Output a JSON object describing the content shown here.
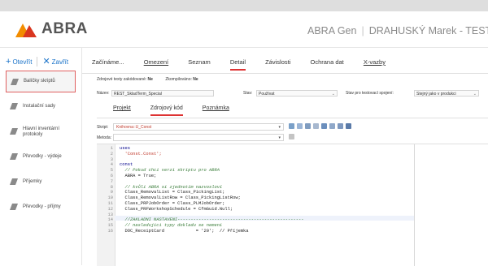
{
  "header": {
    "logo": "ABRA",
    "product": "ABRA Gen",
    "user": "DRAHUSKÝ Marek - TEST",
    "colors": {
      "logo_orange": "#f28c00",
      "logo_red": "#d9361f"
    }
  },
  "sidebar": {
    "open_label": "Otevřít",
    "close_label": "Zavřít",
    "items": [
      {
        "label": "Balíčky skriptů",
        "active": true
      },
      {
        "label": "Instalační sady"
      },
      {
        "label": "Hlavní inventární protokoly"
      },
      {
        "label": "Převodky - výdeje"
      },
      {
        "label": "Příjemky"
      },
      {
        "label": "Převodky - příjmy"
      }
    ]
  },
  "main_tabs": [
    "Začínáme...",
    "Omezení",
    "Seznam",
    "Detail",
    "Závislosti",
    "Ochrana dat",
    "X-vazby"
  ],
  "active_main_tab": "Detail",
  "info": {
    "encrypted_label": "Zdrojové texty zakódované:",
    "encrypted_value": "Ne",
    "compiled_label": "Zkompilováno:",
    "compiled_value": "Ne"
  },
  "form": {
    "name_label": "Název:",
    "name_value": "REST_SkladTerm_Special",
    "status_label": "Stav:",
    "status_value": "Používat",
    "test_label": "Stav pro testovací spojení:",
    "test_value": "Stejný jako v produkci"
  },
  "sub_tabs": [
    "Projekt",
    "Zdrojový kód",
    "Poznámka"
  ],
  "active_sub_tab": "Zdrojový kód",
  "script": {
    "label": "Skript:",
    "value": "Knihovna::U_Const",
    "method_label": "Metoda:",
    "method_value": ""
  },
  "code": {
    "lines": [
      {
        "n": "1",
        "t": "uses",
        "c": "kw"
      },
      {
        "n": "2",
        "t": "  'Const.Const';",
        "c": "st"
      },
      {
        "n": "3",
        "t": "",
        "c": "nm"
      },
      {
        "n": "4",
        "t": "const",
        "c": "kw"
      },
      {
        "n": "5",
        "t": "  // Pokud chci verzi skriptu pro ABRA",
        "c": "cm"
      },
      {
        "n": "6",
        "t": "  ABRA = True;",
        "c": "nm"
      },
      {
        "n": "7",
        "t": "",
        "c": "nm"
      },
      {
        "n": "8",
        "t": "  // kvůli ABRA si zjednotím nazvosloví",
        "c": "cm"
      },
      {
        "n": "9",
        "t": "  Class_RemovalList = Class_PickingList;",
        "c": "nm"
      },
      {
        "n": "10",
        "t": "  Class_RemovalListRow = Class_PickingListRow;",
        "c": "nm"
      },
      {
        "n": "11",
        "t": "  Class_PRPJobOrder = Class_PLMJobOrder;",
        "c": "nm"
      },
      {
        "n": "12",
        "t": "  Class_PRFWorkshopSchedule = CfmGuid.Null;",
        "c": "nm"
      },
      {
        "n": "13",
        "t": "",
        "c": "nm"
      },
      {
        "n": "14",
        "t": "  //ZAKLADNI NASTAVENI------------------------------------------------",
        "c": "cm"
      },
      {
        "n": "15",
        "t": "  // nasledujici typy dokladu se nemeni",
        "c": "cm"
      },
      {
        "n": "16",
        "t": "  DOC_ReceiptCard            = '20';  // Příjemka",
        "c": "nm"
      }
    ]
  }
}
